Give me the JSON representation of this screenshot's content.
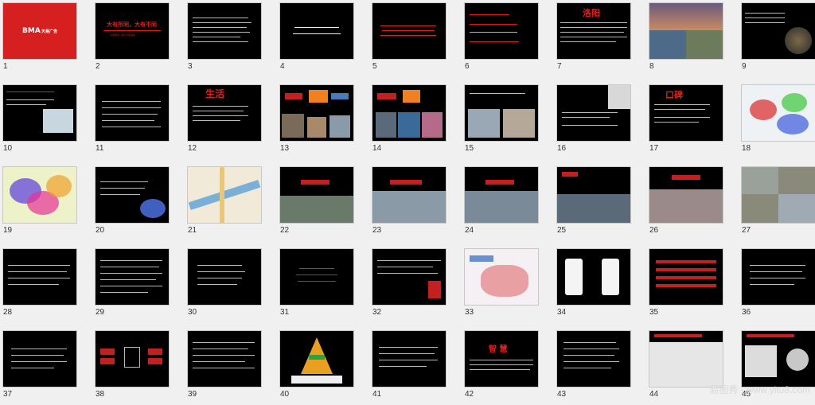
{
  "slides": [
    {
      "n": "1"
    },
    {
      "n": "2"
    },
    {
      "n": "3"
    },
    {
      "n": "4"
    },
    {
      "n": "5"
    },
    {
      "n": "6"
    },
    {
      "n": "7"
    },
    {
      "n": "8"
    },
    {
      "n": "9"
    },
    {
      "n": "10"
    },
    {
      "n": "11"
    },
    {
      "n": "12"
    },
    {
      "n": "13"
    },
    {
      "n": "14"
    },
    {
      "n": "15"
    },
    {
      "n": "16"
    },
    {
      "n": "17"
    },
    {
      "n": "18"
    },
    {
      "n": "19"
    },
    {
      "n": "20"
    },
    {
      "n": "21"
    },
    {
      "n": "22"
    },
    {
      "n": "23"
    },
    {
      "n": "24"
    },
    {
      "n": "25"
    },
    {
      "n": "26"
    },
    {
      "n": "27"
    },
    {
      "n": "28"
    },
    {
      "n": "29"
    },
    {
      "n": "30"
    },
    {
      "n": "31"
    },
    {
      "n": "32"
    },
    {
      "n": "33"
    },
    {
      "n": "34"
    },
    {
      "n": "35"
    },
    {
      "n": "36"
    },
    {
      "n": "37"
    },
    {
      "n": "38"
    },
    {
      "n": "39"
    },
    {
      "n": "40"
    },
    {
      "n": "41"
    },
    {
      "n": "42"
    },
    {
      "n": "43"
    },
    {
      "n": "44"
    },
    {
      "n": "45"
    }
  ],
  "slide_text": {
    "s1_logo": "BMA",
    "s1_logo_sub": "天易广告",
    "s2_title": "大有所同，大有不同",
    "s2_sub": "大有所同·大有不同 提案",
    "s7_title": "洛阳",
    "s12_title": "生活",
    "s17_title": "口碑",
    "s42_title": "智 慧"
  },
  "watermark": "易图秀 · www.yitu8.com",
  "colors": {
    "accent": "#e02020",
    "background": "#000000",
    "page": "#f0f0f0"
  }
}
